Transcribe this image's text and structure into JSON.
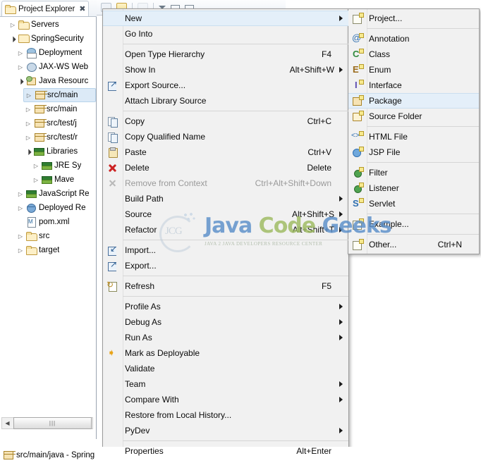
{
  "view": {
    "tab_title": "Project Explorer",
    "close_icon": "close-icon"
  },
  "tree": [
    {
      "label": "Servers",
      "indent": 1,
      "twist": "collapsed",
      "icon": "folder-open-icon",
      "selected": false
    },
    {
      "label": "SpringSecurity",
      "indent": 1,
      "twist": "expanded",
      "icon": "maven-project-icon",
      "selected": false
    },
    {
      "label": "Deployment",
      "indent": 2,
      "twist": "collapsed",
      "icon": "deployment-descriptor-icon",
      "selected": false
    },
    {
      "label": "JAX-WS Web",
      "indent": 2,
      "twist": "collapsed",
      "icon": "jaxws-icon",
      "selected": false
    },
    {
      "label": "Java Resourc",
      "indent": 2,
      "twist": "expanded",
      "icon": "java-resources-icon",
      "selected": false
    },
    {
      "label": "src/main",
      "indent": 3,
      "twist": "collapsed",
      "icon": "package-folder-icon",
      "selected": true
    },
    {
      "label": "src/main",
      "indent": 3,
      "twist": "collapsed",
      "icon": "package-folder-icon",
      "selected": false
    },
    {
      "label": "src/test/j",
      "indent": 3,
      "twist": "collapsed",
      "icon": "package-folder-icon",
      "selected": false
    },
    {
      "label": "src/test/r",
      "indent": 3,
      "twist": "collapsed",
      "icon": "package-folder-icon",
      "selected": false
    },
    {
      "label": "Libraries",
      "indent": 3,
      "twist": "expanded",
      "icon": "libraries-icon",
      "selected": false
    },
    {
      "label": "JRE Sy",
      "indent": 4,
      "twist": "collapsed",
      "icon": "libraries-icon",
      "selected": false
    },
    {
      "label": "Mave",
      "indent": 4,
      "twist": "collapsed",
      "icon": "libraries-icon",
      "selected": false
    },
    {
      "label": "JavaScript Re",
      "indent": 2,
      "twist": "collapsed",
      "icon": "libraries-icon",
      "selected": false
    },
    {
      "label": "Deployed Re",
      "indent": 2,
      "twist": "collapsed",
      "icon": "deployed-resources-icon",
      "selected": false
    },
    {
      "label": "pom.xml",
      "indent": 2,
      "twist": "none",
      "icon": "xml-file-icon",
      "selected": false
    },
    {
      "label": "src",
      "indent": 2,
      "twist": "collapsed",
      "icon": "folder-open-icon",
      "selected": false
    },
    {
      "label": "target",
      "indent": 2,
      "twist": "collapsed",
      "icon": "folder-open-icon",
      "selected": false
    }
  ],
  "statusbar": {
    "text": "src/main/java - Spring",
    "icon": "package-folder-icon"
  },
  "toolbar": {
    "buttons": [
      {
        "name": "collapse-all-button",
        "style": "plain"
      },
      {
        "name": "link-with-editor-button",
        "style": "active"
      },
      {
        "name": "focus-button",
        "style": "faint"
      },
      {
        "name": "view-menu-button",
        "style": "triangle"
      },
      {
        "name": "minimize-button",
        "style": "flat"
      },
      {
        "name": "maximize-button",
        "style": "flat"
      }
    ]
  },
  "context_menu": {
    "items": [
      {
        "label": "New",
        "accel": "",
        "submenu": true,
        "icon": "",
        "sep_after": false,
        "highlighted": true,
        "disabled": false
      },
      {
        "label": "Go Into",
        "accel": "",
        "submenu": false,
        "icon": "",
        "sep_after": true,
        "highlighted": false,
        "disabled": false
      },
      {
        "label": "Open Type Hierarchy",
        "accel": "F4",
        "submenu": false,
        "icon": "",
        "sep_after": false,
        "highlighted": false,
        "disabled": false
      },
      {
        "label": "Show In",
        "accel": "Alt+Shift+W",
        "submenu": true,
        "icon": "",
        "sep_after": false,
        "highlighted": false,
        "disabled": false
      },
      {
        "label": "Export Source...",
        "accel": "",
        "submenu": false,
        "icon": "export-icon",
        "sep_after": false,
        "highlighted": false,
        "disabled": false
      },
      {
        "label": "Attach Library Source",
        "accel": "",
        "submenu": false,
        "icon": "",
        "sep_after": true,
        "highlighted": false,
        "disabled": false
      },
      {
        "label": "Copy",
        "accel": "Ctrl+C",
        "submenu": false,
        "icon": "copy-icon",
        "sep_after": false,
        "highlighted": false,
        "disabled": false
      },
      {
        "label": "Copy Qualified Name",
        "accel": "",
        "submenu": false,
        "icon": "copy-icon",
        "sep_after": false,
        "highlighted": false,
        "disabled": false
      },
      {
        "label": "Paste",
        "accel": "Ctrl+V",
        "submenu": false,
        "icon": "paste-icon",
        "sep_after": false,
        "highlighted": false,
        "disabled": false
      },
      {
        "label": "Delete",
        "accel": "Delete",
        "submenu": false,
        "icon": "delete-icon",
        "sep_after": false,
        "highlighted": false,
        "disabled": false
      },
      {
        "label": "Remove from Context",
        "accel": "Ctrl+Alt+Shift+Down",
        "submenu": false,
        "icon": "remove-icon",
        "sep_after": false,
        "highlighted": false,
        "disabled": true
      },
      {
        "label": "Build Path",
        "accel": "",
        "submenu": true,
        "icon": "",
        "sep_after": false,
        "highlighted": false,
        "disabled": false
      },
      {
        "label": "Source",
        "accel": "Alt+Shift+S",
        "submenu": true,
        "icon": "",
        "sep_after": false,
        "highlighted": false,
        "disabled": false
      },
      {
        "label": "Refactor",
        "accel": "Alt+Shift+T",
        "submenu": true,
        "icon": "",
        "sep_after": true,
        "highlighted": false,
        "disabled": false
      },
      {
        "label": "Import...",
        "accel": "",
        "submenu": false,
        "icon": "import-icon",
        "sep_after": false,
        "highlighted": false,
        "disabled": false
      },
      {
        "label": "Export...",
        "accel": "",
        "submenu": false,
        "icon": "export-icon",
        "sep_after": true,
        "highlighted": false,
        "disabled": false
      },
      {
        "label": "Refresh",
        "accel": "F5",
        "submenu": false,
        "icon": "refresh-icon",
        "sep_after": true,
        "highlighted": false,
        "disabled": false
      },
      {
        "label": "Profile As",
        "accel": "",
        "submenu": true,
        "icon": "",
        "sep_after": false,
        "highlighted": false,
        "disabled": false
      },
      {
        "label": "Debug As",
        "accel": "",
        "submenu": true,
        "icon": "",
        "sep_after": false,
        "highlighted": false,
        "disabled": false
      },
      {
        "label": "Run As",
        "accel": "",
        "submenu": true,
        "icon": "",
        "sep_after": false,
        "highlighted": false,
        "disabled": false
      },
      {
        "label": "Mark as Deployable",
        "accel": "",
        "submenu": false,
        "icon": "deploy-icon",
        "sep_after": false,
        "highlighted": false,
        "disabled": false
      },
      {
        "label": "Validate",
        "accel": "",
        "submenu": false,
        "icon": "",
        "sep_after": false,
        "highlighted": false,
        "disabled": false
      },
      {
        "label": "Team",
        "accel": "",
        "submenu": true,
        "icon": "",
        "sep_after": false,
        "highlighted": false,
        "disabled": false
      },
      {
        "label": "Compare With",
        "accel": "",
        "submenu": true,
        "icon": "",
        "sep_after": false,
        "highlighted": false,
        "disabled": false
      },
      {
        "label": "Restore from Local History...",
        "accel": "",
        "submenu": false,
        "icon": "",
        "sep_after": false,
        "highlighted": false,
        "disabled": false
      },
      {
        "label": "PyDev",
        "accel": "",
        "submenu": true,
        "icon": "",
        "sep_after": true,
        "highlighted": false,
        "disabled": false
      },
      {
        "label": "Properties",
        "accel": "Alt+Enter",
        "submenu": false,
        "icon": "",
        "sep_after": false,
        "highlighted": false,
        "disabled": false
      }
    ]
  },
  "submenu": {
    "items": [
      {
        "label": "Project...",
        "accel": "",
        "icon": "new-project-icon",
        "sep_after": true,
        "highlighted": false
      },
      {
        "label": "Annotation",
        "accel": "",
        "icon": "new-annotation-icon",
        "sep_after": false,
        "highlighted": false
      },
      {
        "label": "Class",
        "accel": "",
        "icon": "new-class-icon",
        "sep_after": false,
        "highlighted": false
      },
      {
        "label": "Enum",
        "accel": "",
        "icon": "new-enum-icon",
        "sep_after": false,
        "highlighted": false
      },
      {
        "label": "Interface",
        "accel": "",
        "icon": "new-interface-icon",
        "sep_after": false,
        "highlighted": false
      },
      {
        "label": "Package",
        "accel": "",
        "icon": "new-package-icon",
        "sep_after": false,
        "highlighted": true
      },
      {
        "label": "Source Folder",
        "accel": "",
        "icon": "new-source-folder-icon",
        "sep_after": true,
        "highlighted": false
      },
      {
        "label": "HTML File",
        "accel": "",
        "icon": "new-html-file-icon",
        "sep_after": false,
        "highlighted": false
      },
      {
        "label": "JSP File",
        "accel": "",
        "icon": "new-jsp-file-icon",
        "sep_after": true,
        "highlighted": false
      },
      {
        "label": "Filter",
        "accel": "",
        "icon": "new-filter-icon",
        "sep_after": false,
        "highlighted": false
      },
      {
        "label": "Listener",
        "accel": "",
        "icon": "new-listener-icon",
        "sep_after": false,
        "highlighted": false
      },
      {
        "label": "Servlet",
        "accel": "",
        "icon": "new-servlet-icon",
        "sep_after": true,
        "highlighted": false
      },
      {
        "label": "Example...",
        "accel": "",
        "icon": "new-example-icon",
        "sep_after": true,
        "highlighted": false
      },
      {
        "label": "Other...",
        "accel": "Ctrl+N",
        "icon": "new-other-icon",
        "sep_after": false,
        "highlighted": false
      }
    ]
  },
  "watermark": {
    "brand_word1": "Java",
    "brand_word2": "Code",
    "brand_word3": "Geeks",
    "logo_text": "JCG",
    "tagline": "JAVA 2 JAVA DEVELOPERS RESOURCE CENTER"
  },
  "colors": {
    "selection_blue": "#dceaf7",
    "menu_bg": "#f1f1f1",
    "menu_highlight": "#e4eff9",
    "statusbar_band": "#dfe3ef",
    "brand_blue": "#5b8fc9",
    "brand_green": "#9dbb61"
  }
}
